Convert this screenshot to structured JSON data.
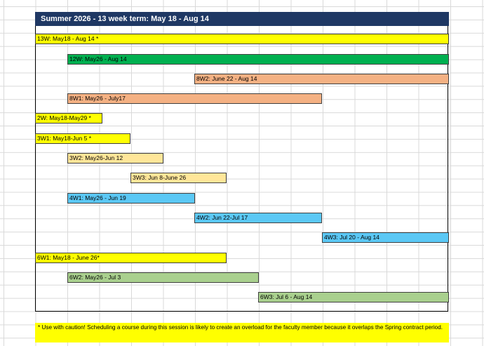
{
  "header": {
    "title": "Summer 2026 - 13 week term: May 18 - Aug 14"
  },
  "bars": [
    {
      "label": "13W: May18 - Aug 14 *",
      "color": "#ffff00"
    },
    {
      "label": "12W: May26 - Aug 14",
      "color": "#00b050"
    },
    {
      "label": "8W2: June 22 - Aug 14",
      "color": "#f4b183"
    },
    {
      "label": "8W1: May26 - July17",
      "color": "#f4b183"
    },
    {
      "label": "2W: May18-May29 *",
      "color": "#ffff00"
    },
    {
      "label": "3W1: May18-Jun 5 *",
      "color": "#ffff00"
    },
    {
      "label": "3W2: May26-Jun 12",
      "color": "#ffe699"
    },
    {
      "label": "3W3: Jun 8-June 26",
      "color": "#ffe699"
    },
    {
      "label": "4W1: May26 - Jun 19",
      "color": "#5bc8f5"
    },
    {
      "label": "4W2: Jun 22-Jul 17",
      "color": "#5bc8f5"
    },
    {
      "label": "4W3: Jul 20 - Aug 14",
      "color": "#5bc8f5"
    },
    {
      "label": "6W1: May18 - June 26*",
      "color": "#ffff00"
    },
    {
      "label": "6W2: May26 - Jul 3",
      "color": "#a9d08e"
    },
    {
      "label": "6W3: Jul 6 - Aug 14",
      "color": "#a9d08e"
    }
  ],
  "caution": {
    "text": "* Use with caution! Scheduling a course during this session is likely to create an overload for the faculty member because it overlaps the Spring contract period."
  }
}
